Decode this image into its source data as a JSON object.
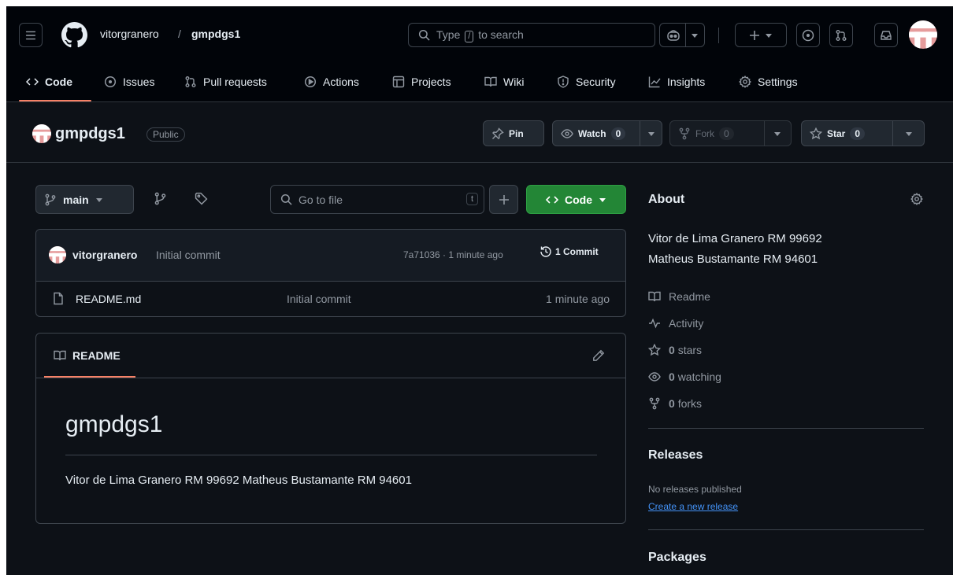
{
  "header": {
    "owner": "vitorgranero",
    "separator": "/",
    "repo": "gmpdgs1",
    "search": {
      "prefix": "Type",
      "key": "/",
      "suffix": "to search"
    }
  },
  "nav": {
    "tabs": [
      {
        "label": "Code",
        "icon": "code-icon",
        "active": true
      },
      {
        "label": "Issues",
        "icon": "issue-icon"
      },
      {
        "label": "Pull requests",
        "icon": "pull-request-icon"
      },
      {
        "label": "Actions",
        "icon": "play-icon"
      },
      {
        "label": "Projects",
        "icon": "table-icon"
      },
      {
        "label": "Wiki",
        "icon": "book-icon"
      },
      {
        "label": "Security",
        "icon": "shield-icon"
      },
      {
        "label": "Insights",
        "icon": "graph-icon"
      },
      {
        "label": "Settings",
        "icon": "gear-icon"
      }
    ]
  },
  "repo_header": {
    "name": "gmpdgs1",
    "visibility": "Public",
    "pin": "Pin",
    "watch": {
      "label": "Watch",
      "count": "0"
    },
    "fork": {
      "label": "Fork",
      "count": "0"
    },
    "star": {
      "label": "Star",
      "count": "0"
    }
  },
  "file_bar": {
    "branch": "main",
    "goto_placeholder": "Go to file",
    "goto_key": "t",
    "add_label": "+",
    "code_button": "Code"
  },
  "commit": {
    "author": "vitorgranero",
    "message": "Initial commit",
    "meta": "7a71036 · 1 minute ago",
    "count": "1 Commit"
  },
  "files": [
    {
      "name": "README.md",
      "message": "Initial commit",
      "age": "1 minute ago"
    }
  ],
  "readme": {
    "tab": "README",
    "title": "gmpdgs1",
    "body": "Vitor de Lima Granero RM 99692 Matheus Bustamante RM 94601"
  },
  "about": {
    "heading": "About",
    "desc_line1": "Vitor de Lima Granero RM 99692",
    "desc_line2": "Matheus Bustamante RM 94601",
    "readme": "Readme",
    "activity": "Activity",
    "stars_count": "0",
    "stars_label": "stars",
    "watching_count": "0",
    "watching_label": "watching",
    "forks_count": "0",
    "forks_label": "forks"
  },
  "releases": {
    "heading": "Releases",
    "none": "No releases published",
    "create": "Create a new release"
  },
  "packages": {
    "heading": "Packages"
  },
  "colors": {
    "bg": "#0d1117",
    "header": "#010409",
    "border": "#3d444d",
    "accent": "#f78166",
    "green": "#238636",
    "link": "#4493f8"
  }
}
